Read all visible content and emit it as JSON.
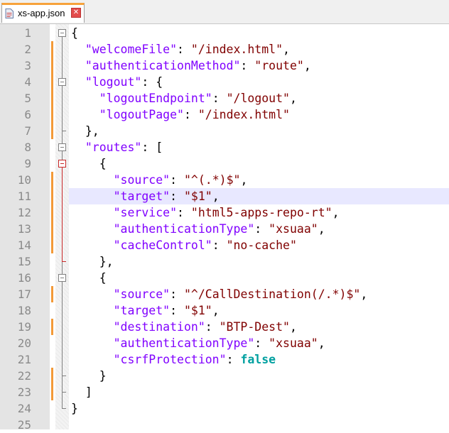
{
  "tab": {
    "label": "xs-app.json",
    "close_glyph": "✕",
    "icon": "file-icon"
  },
  "editor": {
    "current_line": 11,
    "lines": [
      {
        "n": "1",
        "code": [
          [
            "op",
            "{"
          ]
        ]
      },
      {
        "n": "2",
        "code": [
          [
            "op",
            "  "
          ],
          [
            "str",
            "\"welcomeFile\""
          ],
          [
            "op",
            ": "
          ],
          [
            "str",
            "\"/index.html\""
          ],
          [
            "op",
            ","
          ]
        ]
      },
      {
        "n": "3",
        "code": [
          [
            "op",
            "  "
          ],
          [
            "str",
            "\"authenticationMethod\""
          ],
          [
            "op",
            ": "
          ],
          [
            "str",
            "\"route\""
          ],
          [
            "op",
            ","
          ]
        ]
      },
      {
        "n": "4",
        "code": [
          [
            "op",
            "  "
          ],
          [
            "str",
            "\"logout\""
          ],
          [
            "op",
            ": {"
          ]
        ]
      },
      {
        "n": "5",
        "code": [
          [
            "op",
            "    "
          ],
          [
            "str",
            "\"logoutEndpoint\""
          ],
          [
            "op",
            ": "
          ],
          [
            "str",
            "\"/logout\""
          ],
          [
            "op",
            ","
          ]
        ]
      },
      {
        "n": "6",
        "code": [
          [
            "op",
            "    "
          ],
          [
            "str",
            "\"logoutPage\""
          ],
          [
            "op",
            ": "
          ],
          [
            "str",
            "\"/index.html\""
          ]
        ]
      },
      {
        "n": "7",
        "code": [
          [
            "op",
            "  },"
          ]
        ]
      },
      {
        "n": "8",
        "code": [
          [
            "op",
            "  "
          ],
          [
            "str",
            "\"routes\""
          ],
          [
            "op",
            ": ["
          ]
        ]
      },
      {
        "n": "9",
        "code": [
          [
            "op",
            "    {"
          ]
        ]
      },
      {
        "n": "10",
        "code": [
          [
            "op",
            "      "
          ],
          [
            "str",
            "\"source\""
          ],
          [
            "op",
            ": "
          ],
          [
            "str",
            "\"^(.*)$\""
          ],
          [
            "op",
            ","
          ]
        ]
      },
      {
        "n": "11",
        "code": [
          [
            "op",
            "      "
          ],
          [
            "str",
            "\"target\""
          ],
          [
            "op",
            ": "
          ],
          [
            "str",
            "\"$1\""
          ],
          [
            "op",
            ","
          ]
        ]
      },
      {
        "n": "12",
        "code": [
          [
            "op",
            "      "
          ],
          [
            "str",
            "\"service\""
          ],
          [
            "op",
            ": "
          ],
          [
            "str",
            "\"html5-apps-repo-rt\""
          ],
          [
            "op",
            ","
          ]
        ]
      },
      {
        "n": "13",
        "code": [
          [
            "op",
            "      "
          ],
          [
            "str",
            "\"authenticationType\""
          ],
          [
            "op",
            ": "
          ],
          [
            "str",
            "\"xsuaa\""
          ],
          [
            "op",
            ","
          ]
        ]
      },
      {
        "n": "14",
        "code": [
          [
            "op",
            "      "
          ],
          [
            "str",
            "\"cacheControl\""
          ],
          [
            "op",
            ": "
          ],
          [
            "str",
            "\"no-cache\""
          ]
        ]
      },
      {
        "n": "15",
        "code": [
          [
            "op",
            "    },"
          ]
        ]
      },
      {
        "n": "16",
        "code": [
          [
            "op",
            "    {"
          ]
        ]
      },
      {
        "n": "17",
        "code": [
          [
            "op",
            "      "
          ],
          [
            "str",
            "\"source\""
          ],
          [
            "op",
            ": "
          ],
          [
            "str",
            "\"^/CallDestination(/.*)$\""
          ],
          [
            "op",
            ","
          ]
        ]
      },
      {
        "n": "18",
        "code": [
          [
            "op",
            "      "
          ],
          [
            "str",
            "\"target\""
          ],
          [
            "op",
            ": "
          ],
          [
            "str",
            "\"$1\""
          ],
          [
            "op",
            ","
          ]
        ]
      },
      {
        "n": "19",
        "code": [
          [
            "op",
            "      "
          ],
          [
            "str",
            "\"destination\""
          ],
          [
            "op",
            ": "
          ],
          [
            "str",
            "\"BTP-Dest\""
          ],
          [
            "op",
            ","
          ]
        ]
      },
      {
        "n": "20",
        "code": [
          [
            "op",
            "      "
          ],
          [
            "str",
            "\"authenticationType\""
          ],
          [
            "op",
            ": "
          ],
          [
            "str",
            "\"xsuaa\""
          ],
          [
            "op",
            ","
          ]
        ]
      },
      {
        "n": "21",
        "code": [
          [
            "op",
            "      "
          ],
          [
            "str",
            "\"csrfProtection\""
          ],
          [
            "op",
            ": "
          ],
          [
            "bool",
            "false"
          ]
        ]
      },
      {
        "n": "22",
        "code": [
          [
            "op",
            "    }"
          ]
        ]
      },
      {
        "n": "23",
        "code": [
          [
            "op",
            "  ]"
          ]
        ]
      },
      {
        "n": "24",
        "code": [
          [
            "op",
            "}"
          ]
        ]
      },
      {
        "n": "25",
        "code": []
      }
    ]
  },
  "colors": {
    "key": "#8000ff",
    "string": "#800000",
    "bool": "#00a0a0",
    "change_marker": "#f39a38",
    "current_line": "#e8e8ff",
    "fold_active": "#c82828"
  }
}
